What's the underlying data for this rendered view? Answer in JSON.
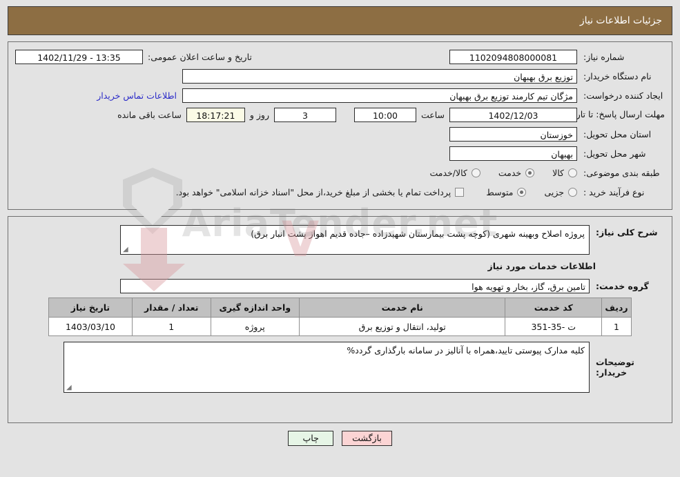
{
  "header": {
    "title": "جزئیات اطلاعات نیاز"
  },
  "form": {
    "need_number_label": "شماره نیاز:",
    "need_number_value": "1102094808000081",
    "announce_label": "تاریخ و ساعت اعلان عمومی:",
    "announce_value": "13:35 - 1402/11/29",
    "org_label": "نام دستگاه خریدار:",
    "org_value": "توزیع برق بهبهان",
    "creator_label": "ایجاد کننده درخواست:",
    "creator_value": "مژگان تیم کارمند توزیع برق بهبهان",
    "contact_link": "اطلاعات تماس خریدار",
    "deadline_label": "مهلت ارسال پاسخ: تا تاریخ:",
    "deadline_date": "1402/12/03",
    "hour_label": "ساعت",
    "hour_value": "10:00",
    "days_value": "3",
    "days_label": "روز و",
    "countdown_value": "18:17:21",
    "countdown_label": "ساعت باقی مانده",
    "province_label": "استان محل تحویل:",
    "province_value": "خوزستان",
    "city_label": "شهر محل تحویل:",
    "city_value": "بهبهان",
    "category_label": "طبقه بندی موضوعی:",
    "category_options": [
      {
        "label": "کالا",
        "selected": false
      },
      {
        "label": "خدمت",
        "selected": true
      },
      {
        "label": "کالا/خدمت",
        "selected": false
      }
    ],
    "process_label": "نوع فرآیند خرید :",
    "process_options": [
      {
        "label": "جزیی",
        "selected": false
      },
      {
        "label": "متوسط",
        "selected": true
      }
    ],
    "treasury_note": "پرداخت تمام یا بخشی از مبلغ خرید،از محل \"اسناد خزانه اسلامی\" خواهد بود.",
    "treasury_checked": false
  },
  "body": {
    "description_label": "شرح کلی نیاز:",
    "description_value": "پروژه اصلاح وبهینه شهری (کوچه پشت بیمارستان شهیدزاده –جاده قدیم اهواز پشت انبار برق)",
    "services_section_title": "اطلاعات خدمات مورد نیاز",
    "service_group_label": "گروه خدمت:",
    "service_group_value": "تامین برق، گاز، بخار و تهویه هوا",
    "table": {
      "columns": [
        "ردیف",
        "کد خدمت",
        "نام خدمت",
        "واحد اندازه گیری",
        "تعداد / مقدار",
        "تاریخ نیاز"
      ],
      "rows": [
        {
          "radif": "1",
          "code": "ت -35-351",
          "name": "تولید، انتقال و توزیع برق",
          "unit": "پروژه",
          "qty": "1",
          "date": "1403/03/10"
        }
      ]
    },
    "notes_label": "توضیحات خریدار:",
    "notes_value": "کلیه مدارک پیوستی تایید،همراه با آنالیز در سامانه بارگذاری گردد%"
  },
  "footer": {
    "back_label": "بازگشت",
    "print_label": "چاپ"
  },
  "watermark": {
    "text": "AriaTender.net",
    "mark": "V"
  },
  "colors": {
    "header_brown": "#8d6e43",
    "page_bg": "#e3e3e3",
    "link_blue": "#2b2bc8",
    "table_header_gray": "#c1c1c1",
    "countdown_bg": "#fbfbe6",
    "back_button_bg": "#fbd4d4",
    "print_button_bg": "#e6f5e6"
  }
}
